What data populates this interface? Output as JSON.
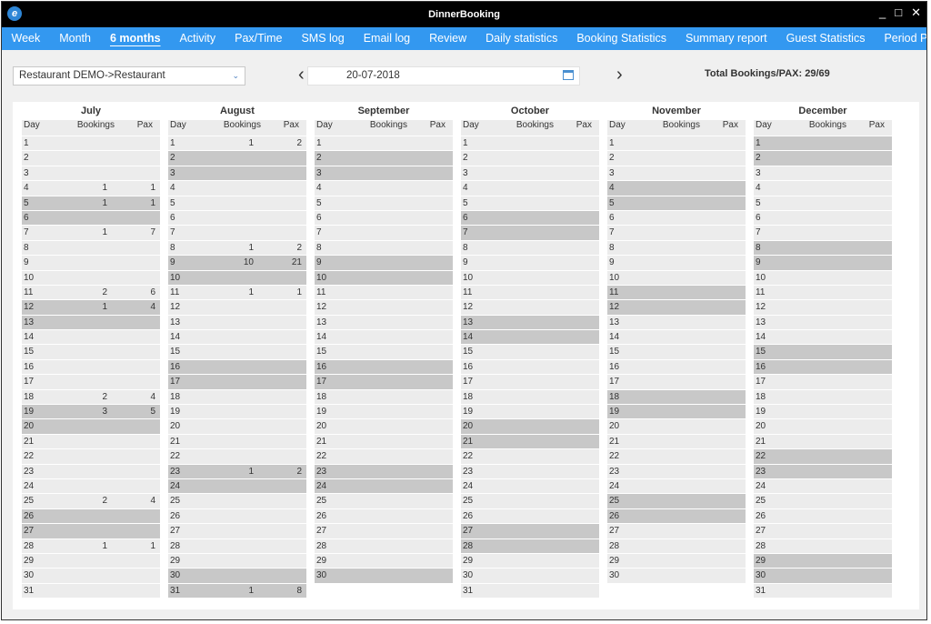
{
  "window": {
    "title": "DinnerBooking",
    "controls": [
      "_",
      "□",
      "✕"
    ]
  },
  "tabs": [
    "Week",
    "Month",
    "6 months",
    "Activity",
    "Pax/Time",
    "SMS log",
    "Email log",
    "Review",
    "Daily statistics",
    "Booking Statistics",
    "Summary report",
    "Guest Statistics",
    "Period Prototype"
  ],
  "active_tab": 2,
  "toolbar": {
    "restaurant": "Restaurant DEMO->Restaurant",
    "date": "20-07-2018",
    "prev": "‹",
    "next": "›",
    "total": "Total Bookings/PAX: 29/69"
  },
  "columns": {
    "day": "Day",
    "bookings": "Bookings",
    "pax": "Pax"
  },
  "months": [
    {
      "name": "July",
      "days": 31,
      "first_weekend": [
        5,
        6
      ],
      "data": {
        "4": [
          1,
          1
        ],
        "5": [
          1,
          1
        ],
        "7": [
          1,
          7
        ],
        "11": [
          2,
          6
        ],
        "12": [
          1,
          4
        ],
        "18": [
          2,
          4
        ],
        "19": [
          3,
          5
        ],
        "25": [
          2,
          4
        ],
        "28": [
          1,
          1
        ]
      }
    },
    {
      "name": "August",
      "days": 31,
      "first_weekend": [
        2,
        3
      ],
      "data": {
        "1": [
          1,
          2
        ],
        "8": [
          1,
          2
        ],
        "9": [
          10,
          21
        ],
        "11": [
          1,
          1
        ],
        "23": [
          1,
          2
        ],
        "31": [
          1,
          8
        ]
      }
    },
    {
      "name": "September",
      "days": 30,
      "first_weekend": [
        2,
        3
      ],
      "data": {}
    },
    {
      "name": "October",
      "days": 31,
      "first_weekend": [
        6,
        7
      ],
      "data": {}
    },
    {
      "name": "November",
      "days": 30,
      "first_weekend": [
        4,
        5
      ],
      "data": {}
    },
    {
      "name": "December",
      "days": 31,
      "first_weekend": [
        1,
        2
      ],
      "data": {}
    }
  ]
}
